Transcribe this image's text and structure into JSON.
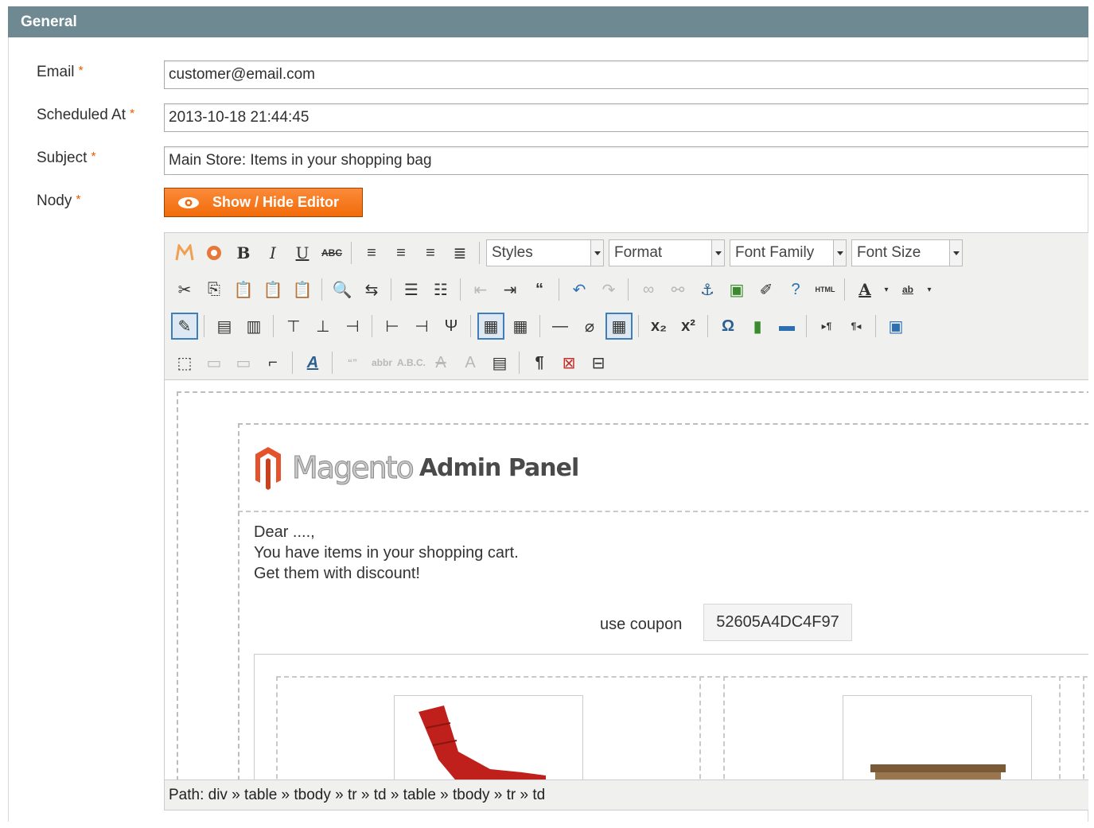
{
  "section": {
    "title": "General"
  },
  "fields": {
    "email": {
      "label": "Email",
      "required_mark": "*",
      "value": "customer@email.com"
    },
    "scheduled": {
      "label": "Scheduled At",
      "required_mark": "*",
      "value": "2013-10-18 21:44:45"
    },
    "subject": {
      "label": "Subject",
      "required_mark": "*",
      "value": "Main Store: Items in your shopping bag"
    },
    "body": {
      "label": "Nody",
      "required_mark": "*"
    }
  },
  "editor_toggle": {
    "label": "Show / Hide Editor"
  },
  "toolbar": {
    "styles": "Styles",
    "format": "Format",
    "font_family": "Font Family",
    "font_size": "Font Size"
  },
  "content": {
    "logo_text": "Magento",
    "logo_sub": "Admin Panel",
    "greeting": "Dear ....,",
    "line1": "You have items in your shopping cart.",
    "line2": "Get them with discount!",
    "coupon_label": "use coupon",
    "coupon_code": "52605A4DC4F97"
  },
  "pathbar": {
    "text": "Path: div » table » tbody » tr » td » table » tbody » tr » td"
  },
  "colors": {
    "legend_bg": "#6f8992",
    "button_orange": "#f16b09",
    "required": "#eb5e00"
  }
}
